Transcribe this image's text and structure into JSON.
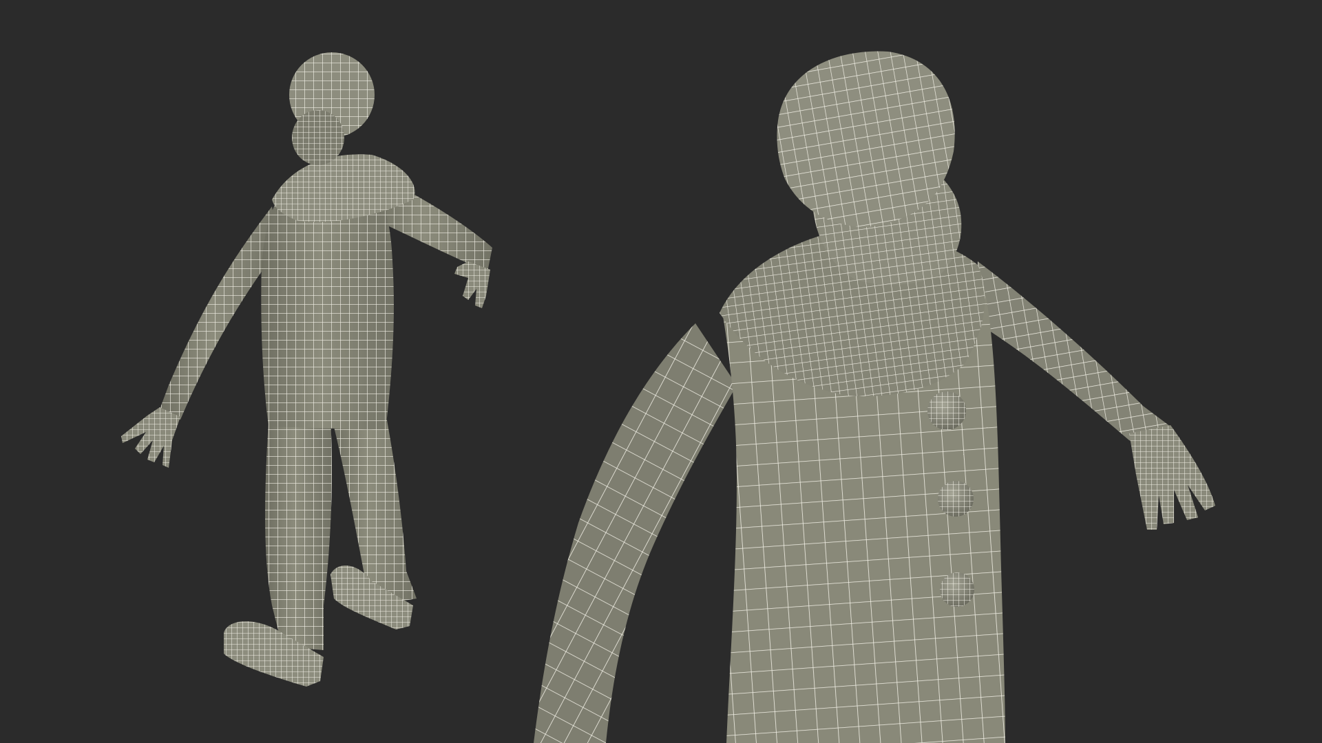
{
  "scene": {
    "background_color": "#2b2b2b",
    "mesh_fill_color": "#878778",
    "mesh_shadow_color": "#6c6c60",
    "mesh_highlight_color": "#a3a394",
    "wire_color": "#f2f0e6",
    "views": [
      {
        "name": "rear-three-quarter-view",
        "subject": "clown-costume-wireframe-figure"
      },
      {
        "name": "front-close-up-view",
        "subject": "clown-costume-wireframe-figure"
      }
    ]
  }
}
